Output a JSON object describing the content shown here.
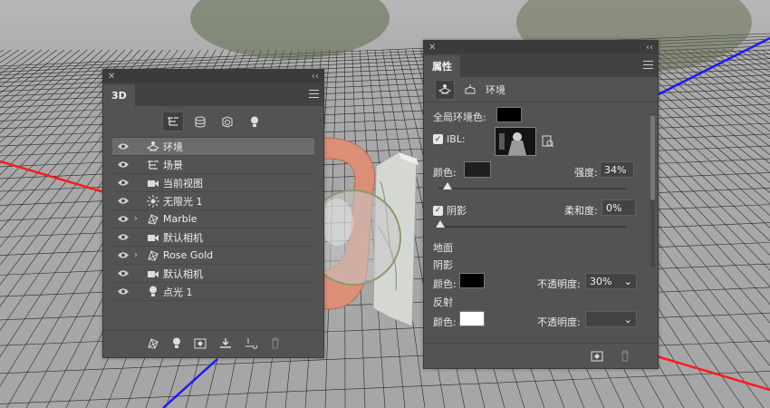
{
  "panel3d": {
    "title": "3D",
    "filters": [
      {
        "name": "scene-filter",
        "icon": "scene-tree-icon"
      },
      {
        "name": "mesh-filter",
        "icon": "mesh-icon"
      },
      {
        "name": "material-filter",
        "icon": "material-icon"
      },
      {
        "name": "light-filter",
        "icon": "bulb-icon"
      }
    ],
    "layers": [
      {
        "label": "环境",
        "icon": "environment-icon",
        "selected": true
      },
      {
        "label": "场景",
        "icon": "scene-tree-icon"
      },
      {
        "label": "当前视图",
        "icon": "camera-icon"
      },
      {
        "label": "无限光 1",
        "icon": "infinite-light-icon"
      },
      {
        "label": "Marble",
        "icon": "mesh-icon",
        "expandable": true
      },
      {
        "label": "默认相机",
        "icon": "camera-icon"
      },
      {
        "label": "Rose Gold",
        "icon": "mesh-icon",
        "expandable": true
      },
      {
        "label": "默认相机",
        "icon": "camera-icon"
      },
      {
        "label": "点光 1",
        "icon": "bulb-icon"
      }
    ],
    "bottom_icons": [
      "mesh-icon",
      "bulb-icon",
      "render-icon",
      "ground-icon",
      "drop-icon",
      "trash-icon"
    ]
  },
  "properties": {
    "title": "属性",
    "section_title": "环境",
    "global_ambient_label": "全局环境色:",
    "global_ambient_color": "#000000",
    "ibl_label": "IBL:",
    "color_label": "颜色:",
    "ibl_color": "#1f1f1f",
    "intensity_label": "强度:",
    "intensity_value": "34%",
    "intensity_level": 0.05,
    "shadow_label": "阴影",
    "softness_label": "柔和度:",
    "softness_value": "0%",
    "softness_level": 0.0,
    "ground_label": "地面",
    "ground_shadow_label": "阴影",
    "ground_shadow_color_label": "颜色:",
    "ground_shadow_color": "#000000",
    "opacity_label": "不透明度:",
    "ground_shadow_opacity": "30%",
    "reflection_label": "反射",
    "reflection_color_label": "颜色:",
    "reflection_color": "#ffffff",
    "reflection_opacity_label": "不透明度:",
    "reflection_opacity": ""
  },
  "colors": {
    "axis_red": "#ff1a1a",
    "axis_blue": "#1a1aff",
    "rose_gold": "#e0957e",
    "marble": "#cfd3ce"
  }
}
